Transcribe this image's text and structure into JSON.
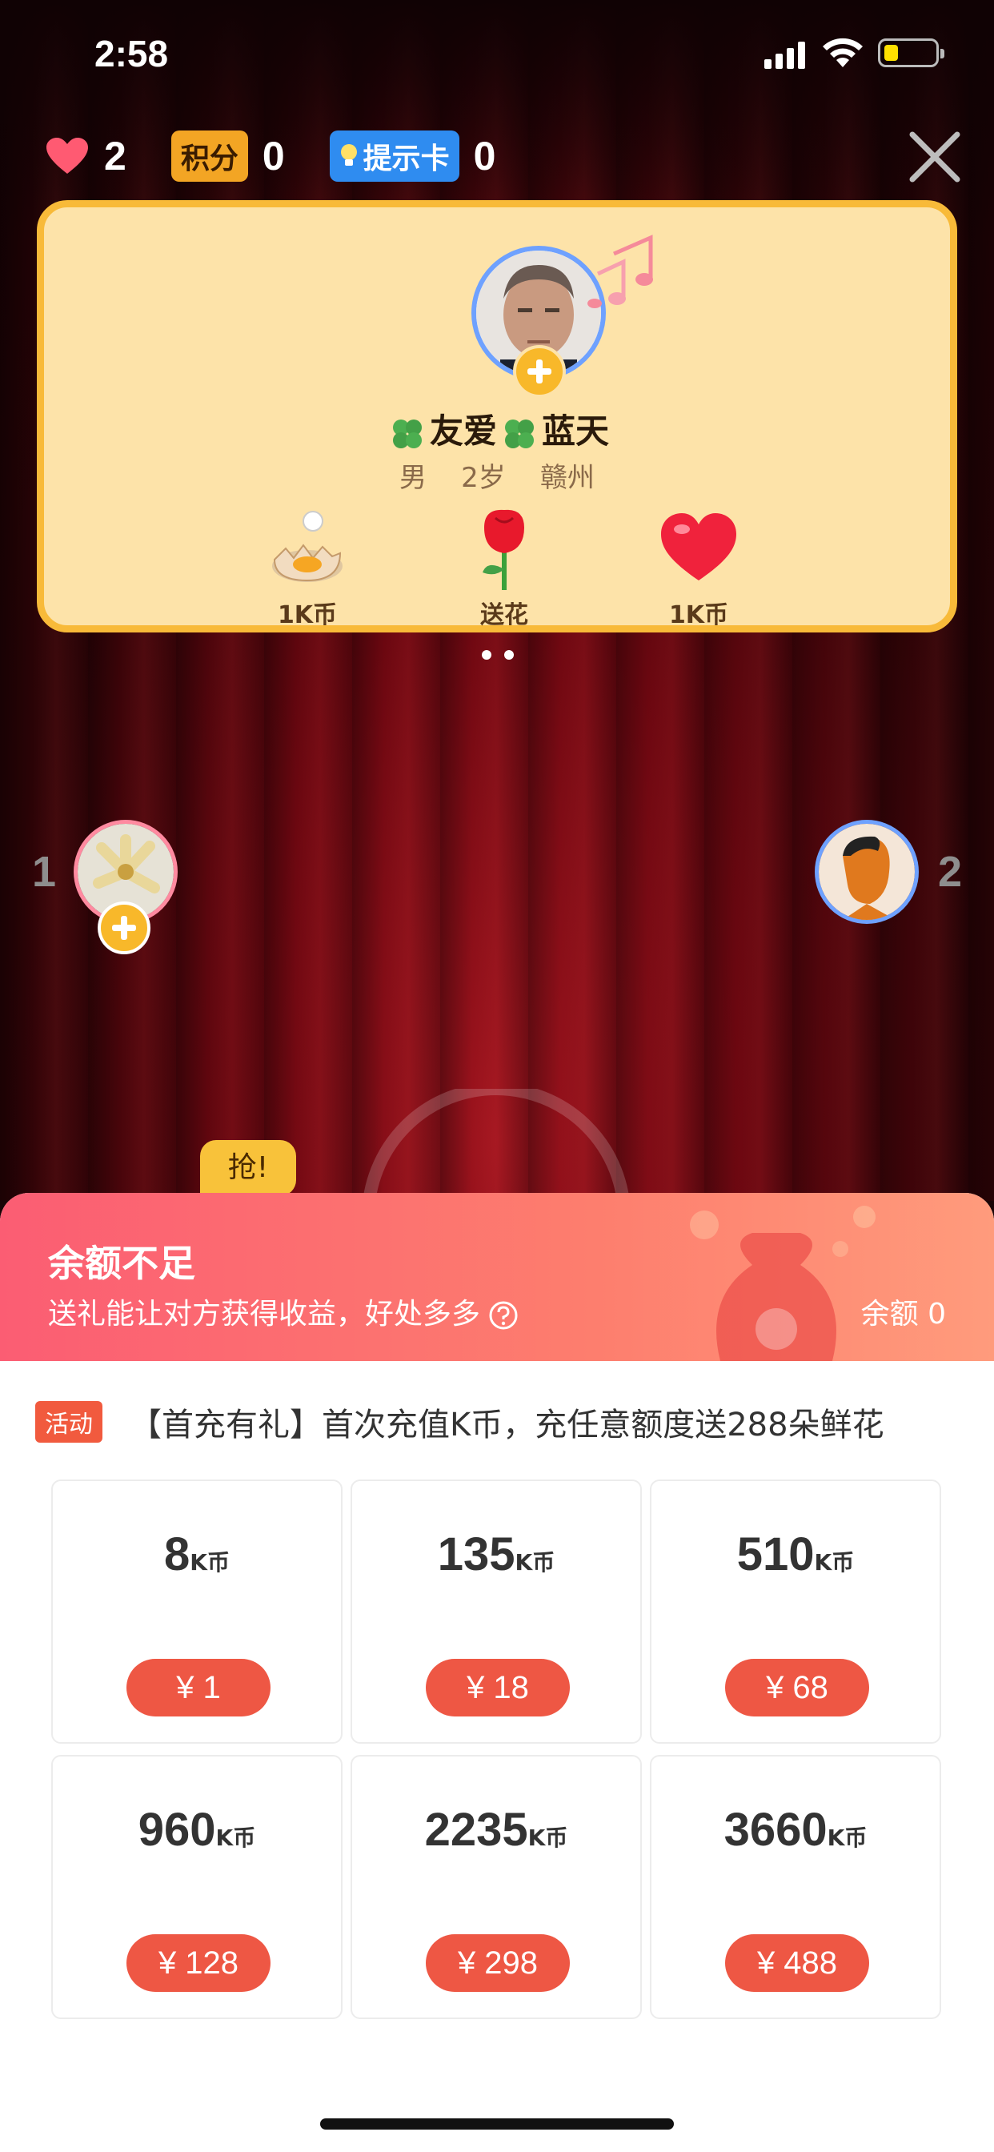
{
  "status_bar": {
    "time": "2:58"
  },
  "top_stats": {
    "hearts": "2",
    "points_label": "积分",
    "points": "0",
    "hint_label": "提示卡",
    "hints": "0"
  },
  "profile": {
    "name_part1": "友爱",
    "name_part2": "蓝天",
    "gender": "男",
    "age": "2岁",
    "city": "赣州",
    "gifts": [
      {
        "icon": "cracked-egg-icon",
        "label": "1K币"
      },
      {
        "icon": "rose-icon",
        "label": "送花"
      },
      {
        "icon": "heart-gift-icon",
        "label": "1K币"
      }
    ]
  },
  "seats": {
    "left_number": "1",
    "right_number": "2",
    "grab_label": "抢!"
  },
  "sheet": {
    "title": "余额不足",
    "subtitle": "送礼能让对方获得收益，好处多多",
    "balance": "余额 0",
    "promo_tag": "活动",
    "promo_text": "【首充有礼】首次充值K币，充任意额度送288朵鲜花",
    "unit": "K币",
    "packages": [
      {
        "amount": "8",
        "price": "¥ 1"
      },
      {
        "amount": "135",
        "price": "¥ 18"
      },
      {
        "amount": "510",
        "price": "¥ 68"
      },
      {
        "amount": "960",
        "price": "¥ 128"
      },
      {
        "amount": "2235",
        "price": "¥ 298"
      },
      {
        "amount": "3660",
        "price": "¥ 488"
      }
    ]
  },
  "colors": {
    "card_bg": "#fde3a9",
    "card_border": "#f8ba39",
    "price_button": "#ee5744",
    "sheet_header_start": "#fb5d73",
    "sheet_header_end": "#ff9b7c"
  }
}
